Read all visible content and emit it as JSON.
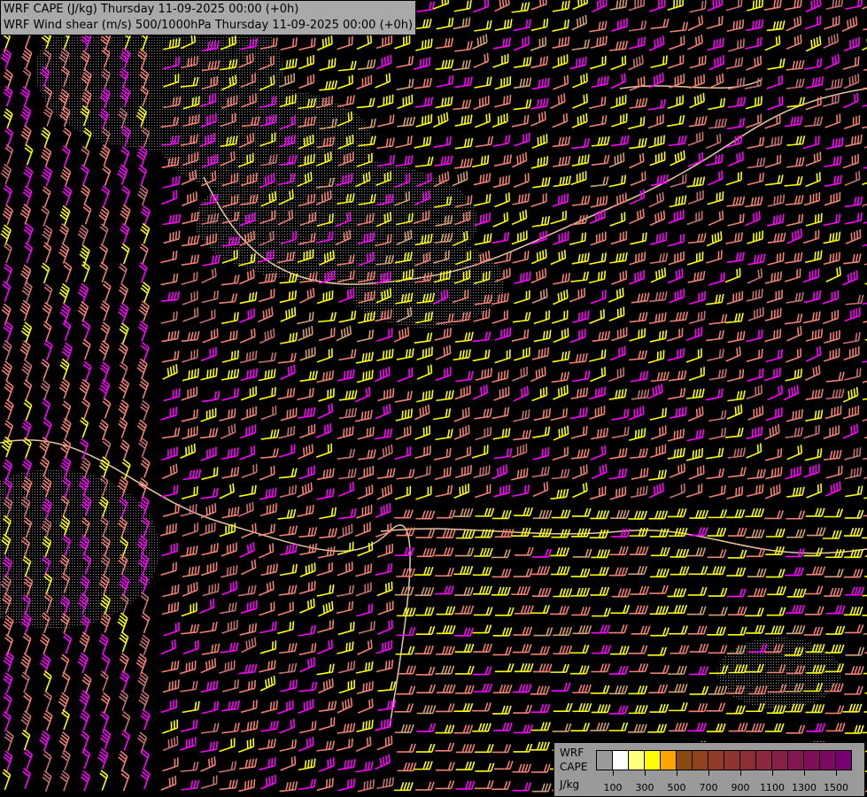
{
  "header": {
    "line1": "WRF CAPE (J/kg) Thursday 11-09-2025 00:00 (+0h)",
    "line2": "WRF Wind shear (m/s) 500/1000hPa Thursday 11-09-2025 00:00 (+0h)"
  },
  "legend": {
    "label1": "WRF",
    "label2": "CAPE",
    "unit": "J/kg",
    "colors": [
      "#9a9a9a",
      "#ffffff",
      "#ffff80",
      "#ffff00",
      "#ffa500",
      "#8b4a14",
      "#8e431e",
      "#903c28",
      "#8e3530",
      "#8c2e36",
      "#89283e",
      "#862046",
      "#82184e",
      "#7f1058",
      "#7c0864",
      "#790070"
    ],
    "ticks": [
      "100",
      "300",
      "500",
      "700",
      "900",
      "1100",
      "1300",
      "1500"
    ]
  },
  "barb_colors": [
    "#ff00ff",
    "#f08070",
    "#ffff00",
    "#d2a070",
    "#c87070"
  ]
}
